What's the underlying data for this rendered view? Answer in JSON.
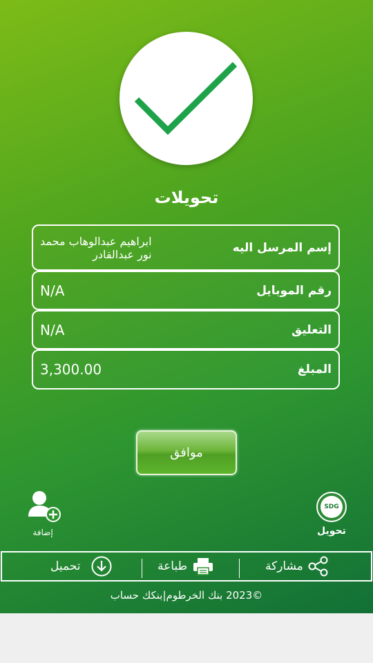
{
  "title": "تحويلات",
  "fields": [
    {
      "label": "إسم المرسل اليه",
      "value_line1": "ابراهيم عبدالوهاب محمد",
      "value_line2": "نور عبدالقادر"
    },
    {
      "label": "رقم الموبايل",
      "value": "N/A"
    },
    {
      "label": "التعليق",
      "value": "N/A"
    },
    {
      "label": "المبلغ",
      "value": "3,300.00"
    }
  ],
  "ok_button": "موافق",
  "add": {
    "label": "إضافة",
    "icon": "add-user-icon"
  },
  "transfer": {
    "badge": "SDG",
    "label": "تحويل"
  },
  "toolbar": {
    "share": {
      "label": "مشاركة",
      "icon": "share-icon"
    },
    "print": {
      "label": "طباعة",
      "icon": "printer-icon"
    },
    "download": {
      "label": "تحميل",
      "icon": "download-icon"
    }
  },
  "footer": "©2023 بنك الخرطوم|بنكك حساب",
  "colors": {
    "check": "#1fa34a",
    "gradient_top": "#7dbb17",
    "gradient_bottom": "#127036"
  }
}
